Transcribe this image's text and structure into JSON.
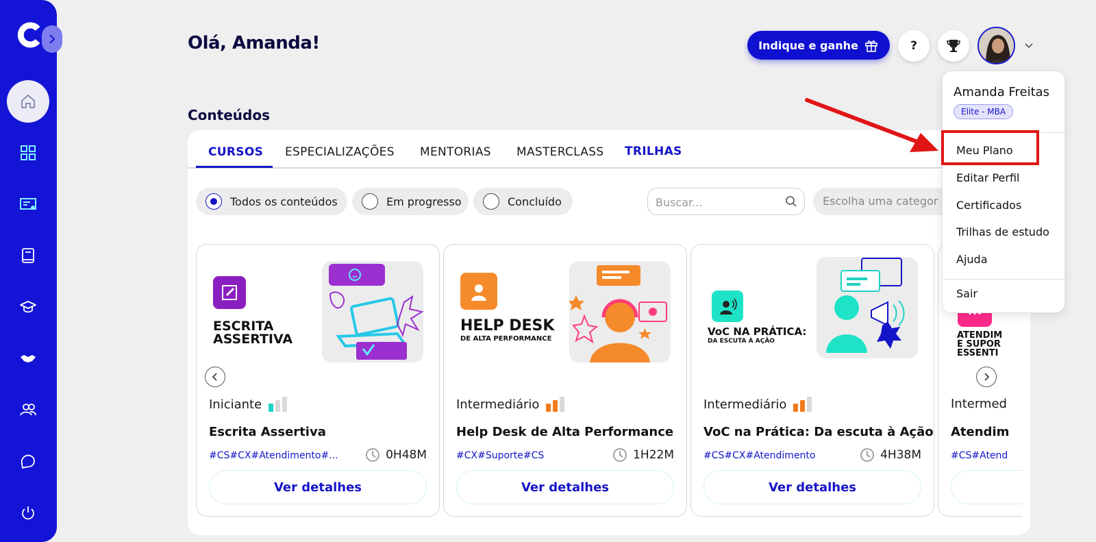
{
  "header": {
    "greeting": "Olá, Amanda!",
    "refer_button": "Indique e ganhe",
    "help_label": "?"
  },
  "section": {
    "title": "Conteúdos"
  },
  "tabs": [
    {
      "label": "CURSOS",
      "active": true
    },
    {
      "label": "ESPECIALIZAÇÕES"
    },
    {
      "label": "MENTORIAS"
    },
    {
      "label": "MASTERCLASS"
    },
    {
      "label": "TRILHAS"
    }
  ],
  "filters": {
    "all": "Todos os conteúdos",
    "in_progress": "Em progresso",
    "completed": "Concluído",
    "selected": "all"
  },
  "search": {
    "placeholder": "Buscar..."
  },
  "category": {
    "placeholder": "Escolha uma categor"
  },
  "cards": [
    {
      "thumb_line1": "ESCRITA",
      "thumb_line2": "ASSERTIVA",
      "level": "Iniciante",
      "level_value": 1,
      "title": "Escrita Assertiva",
      "tags": "#CS#CX#Atendimento#...",
      "duration": "0H48M",
      "button": "Ver detalhes"
    },
    {
      "thumb_line1": "HELP DESK",
      "thumb_line2": "DE ALTA PERFORMANCE",
      "level": "Intermediário",
      "level_value": 2,
      "title": "Help Desk de Alta Performance",
      "tags": "#CX#Suporte#CS",
      "duration": "1H22M",
      "button": "Ver detalhes"
    },
    {
      "thumb_line1": "VoC NA PRÁTICA:",
      "thumb_line2": "DA ESCUTA À AÇÃO",
      "level": "Intermediário",
      "level_value": 2,
      "title": "VoC na Prática: Da escuta à Ação",
      "tags": "#CS#CX#Atendimento",
      "duration": "4H38M",
      "button": "Ver detalhes"
    },
    {
      "thumb_line1": "ATENDIM",
      "thumb_line2": "E SUPOR",
      "thumb_line3": "ESSENTI",
      "level": "Intermed",
      "title": "Atendim",
      "tags": "#CS#Atend"
    }
  ],
  "dropdown": {
    "user_name": "Amanda Freitas",
    "plan_badge": "Elite - MBA",
    "items": [
      "Meu Plano",
      "Editar Perfil",
      "Certificados",
      "Trilhas de estudo",
      "Ajuda"
    ],
    "logout": "Sair"
  },
  "colors": {
    "brand": "#1414d6",
    "highlight": "#e01616",
    "level_beginner": "#1fd1c3",
    "level_intermediate": "#f07b1e"
  },
  "icons": [
    "logo",
    "expand-icon",
    "home-icon",
    "dashboard-icon",
    "certificate-icon",
    "book-icon",
    "graduation-cap-icon",
    "handshake-icon",
    "users-icon",
    "chat-icon",
    "power-icon",
    "gift-icon",
    "trophy-icon",
    "chevron-down-icon",
    "search-icon",
    "clock-icon"
  ]
}
